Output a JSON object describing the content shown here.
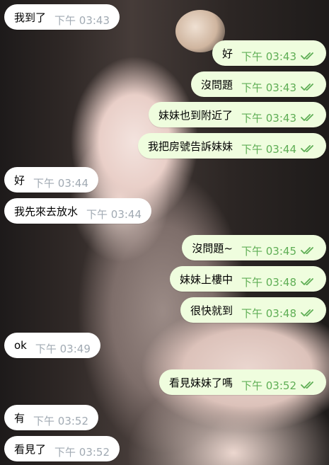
{
  "messages": [
    {
      "dir": "in",
      "text": "我到了",
      "time": "下午 03:43"
    },
    {
      "dir": "out",
      "text": "好",
      "time": "下午 03:43"
    },
    {
      "dir": "out",
      "text": "沒問題",
      "time": "下午 03:43"
    },
    {
      "dir": "out",
      "text": "妹妹也到附近了",
      "time": "下午 03:43"
    },
    {
      "dir": "out",
      "text": "我把房號告訴妹妹",
      "time": "下午 03:44"
    },
    {
      "dir": "in",
      "text": "好",
      "time": "下午 03:44"
    },
    {
      "dir": "in",
      "text": "我先來去放水",
      "time": "下午 03:44"
    },
    {
      "dir": "out",
      "text": "沒問題~",
      "time": "下午 03:45"
    },
    {
      "dir": "out",
      "text": "妹妹上樓中",
      "time": "下午 03:48"
    },
    {
      "dir": "out",
      "text": "很快就到",
      "time": "下午 03:48"
    },
    {
      "dir": "in",
      "text": "ok",
      "time": "下午 03:49"
    },
    {
      "dir": "out",
      "text": "看見妹妹了嗎",
      "time": "下午 03:52"
    },
    {
      "dir": "in",
      "text": "有",
      "time": "下午 03:52"
    },
    {
      "dir": "in",
      "text": "看見了",
      "time": "下午 03:52"
    }
  ],
  "icons": {
    "read_receipt": "double-check-icon"
  },
  "colors": {
    "incoming_bubble": "#ffffff",
    "outgoing_bubble": "#effdde",
    "incoming_time": "#a1aab3",
    "outgoing_time": "#5fae55"
  }
}
